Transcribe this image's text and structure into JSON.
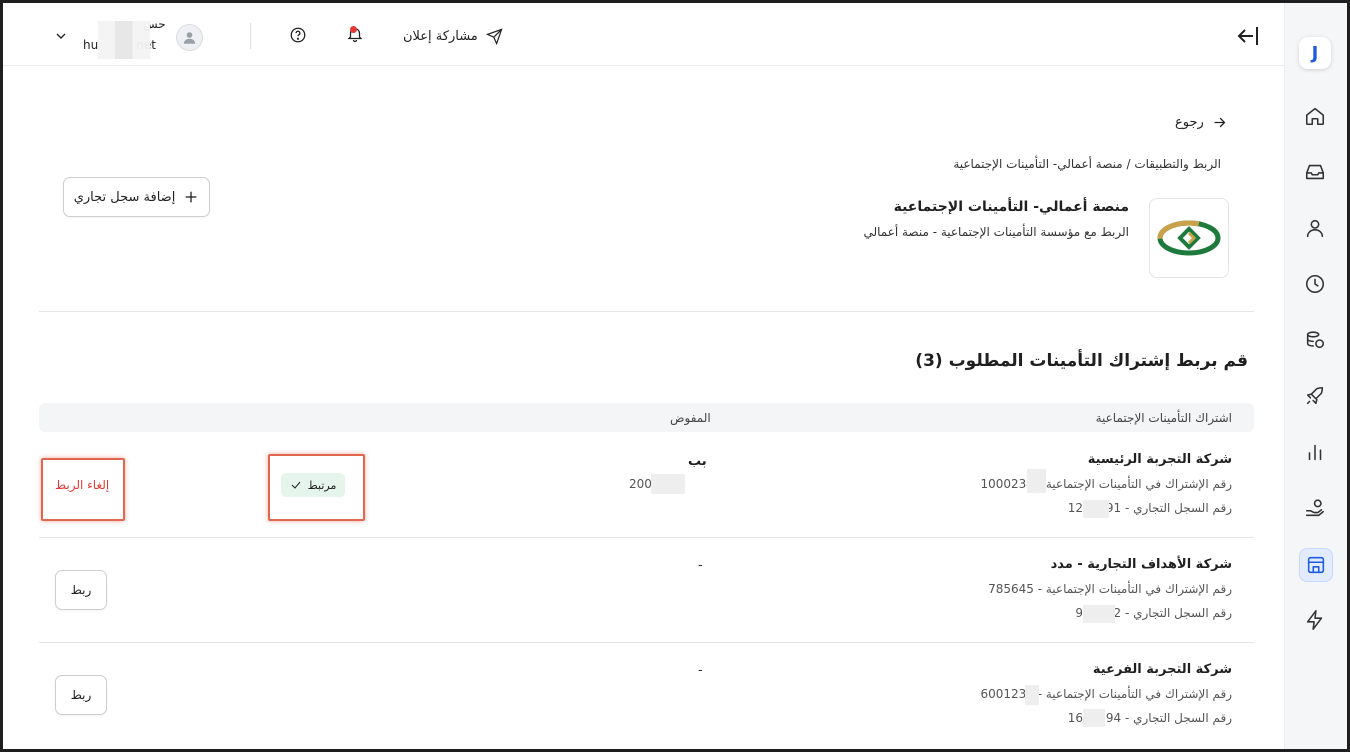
{
  "topbar": {
    "user_name": "حس",
    "user_email": "hu",
    "user_email_suffix": "net",
    "share_label": "مشاركة إعلان"
  },
  "breadcrumb": {
    "back_label": "رجوع",
    "path": "الربط والتطبيقات / منصة أعمالي- التأمينات الإجتماعية"
  },
  "app": {
    "title": "منصة أعمالي- التأمينات الإجتماعية",
    "subtitle": "الربط مع مؤسسة التأمينات الإجتماعية - منصة أعمالي",
    "add_button_label": "إضافة سجل تجاري"
  },
  "section": {
    "title": "قم بربط إشتراك التأمينات المطلوب (3)"
  },
  "table": {
    "headers": {
      "subscription": "اشتراك التأمينات الإجتماعية",
      "delegate": "المفوض"
    },
    "rows": [
      {
        "name": "شركة التجربة الرئيسية",
        "subscription_line": "رقم الإشتراك في التأمينات الإجتماعية - 1000234",
        "cr_line": "رقم السجل التجاري - 1234891",
        "delegate_name": "بب",
        "delegate_id": "200632",
        "status": "مرتبط",
        "action": "إلغاء الربط"
      },
      {
        "name": "شركة الأهداف التجارية - مدد",
        "subscription_line": "رقم الإشتراك في التأمينات الإجتماعية - 785645",
        "cr_line": "رقم السجل التجاري - 987212",
        "delegate_dash": "-",
        "action": "ربط"
      },
      {
        "name": "شركة التجربة الفرعية",
        "subscription_line": "رقم الإشتراك في التأمينات الإجتماعية - 6001234",
        "cr_line": "رقم السجل التجاري - 1633594",
        "delegate_dash": "-",
        "action": "ربط"
      }
    ]
  },
  "sidebar": {
    "logo_letter": "J",
    "items": [
      "home-icon",
      "inbox-icon",
      "user-icon",
      "clock-icon",
      "coins-icon",
      "rocket-icon",
      "bar-chart-icon",
      "hand-coin-icon",
      "store-icon",
      "lightning-icon"
    ],
    "active_item": "store-icon"
  },
  "colors": {
    "accent": "#1f5be0",
    "danger": "#e53935",
    "linked_badge": "#e6f5ec",
    "highlight": "#e06650"
  }
}
